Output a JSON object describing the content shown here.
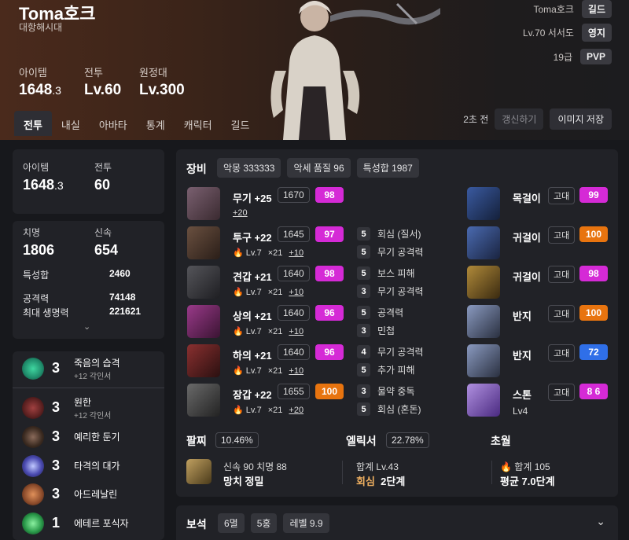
{
  "header": {
    "name": "Toma호크",
    "server": "대항해시대",
    "stats": [
      {
        "label": "아이템",
        "value": "1648",
        "sub": ".3"
      },
      {
        "label": "전투",
        "value": "Lv.60",
        "sub": ""
      },
      {
        "label": "원정대",
        "value": "Lv.300",
        "sub": ""
      }
    ],
    "right": [
      {
        "text": "Toma호크",
        "chip": "길드"
      },
      {
        "text": "Lv.70 서서도",
        "chip": "영지"
      },
      {
        "text": "19급",
        "chip": "PVP"
      }
    ],
    "tabs": [
      "전투",
      "내실",
      "아바타",
      "통계",
      "캐릭터",
      "길드"
    ],
    "refresh": {
      "ago": "2초 전",
      "refresh_label": "갱신하기",
      "save_label": "이미지 저장"
    }
  },
  "summary": {
    "item_label": "아이템",
    "item_value": "1648",
    "item_sub": ".3",
    "combat_label": "전투",
    "combat_value": "60"
  },
  "stats": {
    "crit_label": "치명",
    "crit_value": "1806",
    "swift_label": "신속",
    "swift_value": "654",
    "rows": [
      {
        "label": "특성합",
        "value": "2460"
      },
      {
        "label": "공격력",
        "value": "74148"
      },
      {
        "label": "최대 생명력",
        "value": "221621"
      }
    ],
    "expand": "⌄"
  },
  "engravings": [
    {
      "level": "3",
      "name": "죽음의 습격",
      "sub": "+12 각인서",
      "color": "#1f8a6a"
    },
    {
      "level": "3",
      "name": "원한",
      "sub": "+12 각인서",
      "color": "#6a2a2a"
    },
    {
      "level": "3",
      "name": "예리한 둔기",
      "sub": "",
      "color": "#5a4a3a"
    },
    {
      "level": "3",
      "name": "타격의 대가",
      "sub": "",
      "color": "#4a4ab0"
    },
    {
      "level": "3",
      "name": "아드레날린",
      "sub": "",
      "color": "#8a4a2a"
    },
    {
      "level": "1",
      "name": "에테르 포식자",
      "sub": "",
      "color": "#2a9a4a"
    }
  ],
  "equipment": {
    "title": "장비",
    "tags": [
      "악몽 333333",
      "악세 품질 96",
      "특성합 1987"
    ],
    "items": [
      {
        "name": "무기 +25",
        "ilvl": "1670",
        "quality": "98",
        "qcolor": "#d52ad6",
        "line2": [
          {
            "t": "+20",
            "u": false
          }
        ],
        "color": "#5a4a50"
      },
      {
        "name": "투구 +22",
        "ilvl": "1645",
        "quality": "97",
        "qcolor": "#d52ad6",
        "line2": [
          {
            "t": "🔥 Lv.7",
            "u": false
          },
          {
            "t": "×21",
            "u": false
          },
          {
            "t": "+10",
            "u": true
          }
        ],
        "color": "#4a3a30"
      },
      {
        "name": "견갑 +21",
        "ilvl": "1640",
        "quality": "98",
        "qcolor": "#d52ad6",
        "line2": [
          {
            "t": "🔥 Lv.7",
            "u": false
          },
          {
            "t": "×21",
            "u": false
          },
          {
            "t": "+10",
            "u": true
          }
        ],
        "color": "#3a3a3e"
      },
      {
        "name": "상의 +21",
        "ilvl": "1640",
        "quality": "96",
        "qcolor": "#d52ad6",
        "line2": [
          {
            "t": "🔥 Lv.7",
            "u": false
          },
          {
            "t": "×21",
            "u": false
          },
          {
            "t": "+10",
            "u": true
          }
        ],
        "color": "#6a2a5a"
      },
      {
        "name": "하의 +21",
        "ilvl": "1640",
        "quality": "96",
        "qcolor": "#d52ad6",
        "line2": [
          {
            "t": "🔥 Lv.7",
            "u": false
          },
          {
            "t": "×21",
            "u": false
          },
          {
            "t": "+10",
            "u": true
          }
        ],
        "color": "#5a2a2a"
      },
      {
        "name": "장갑 +22",
        "ilvl": "1655",
        "quality": "100",
        "qcolor": "#e8740f",
        "line2": [
          {
            "t": "🔥 Lv.7",
            "u": false
          },
          {
            "t": "×21",
            "u": false
          },
          {
            "t": "+20",
            "u": true
          }
        ],
        "color": "#4a4a4a"
      }
    ],
    "options": [
      {
        "n": "5",
        "t": "회심 (질서)"
      },
      {
        "n": "5",
        "t": "무기 공격력"
      },
      {
        "n": "5",
        "t": "보스 피해"
      },
      {
        "n": "3",
        "t": "무기 공격력"
      },
      {
        "n": "5",
        "t": "공격력"
      },
      {
        "n": "3",
        "t": "민첩"
      },
      {
        "n": "4",
        "t": "무기 공격력"
      },
      {
        "n": "5",
        "t": "추가 피해"
      },
      {
        "n": "3",
        "t": "물약 중독"
      },
      {
        "n": "5",
        "t": "회심 (혼돈)"
      }
    ],
    "accessories": [
      {
        "name": "목걸이",
        "grade": "고대",
        "quality": "99",
        "qcolor": "#d52ad6",
        "sub": "",
        "color": "#3a4a7a"
      },
      {
        "name": "귀걸이",
        "grade": "고대",
        "quality": "100",
        "qcolor": "#e8740f",
        "sub": "",
        "color": "#3a4a6a"
      },
      {
        "name": "귀걸이",
        "grade": "고대",
        "quality": "98",
        "qcolor": "#d52ad6",
        "sub": "",
        "color": "#6a4a2a"
      },
      {
        "name": "반지",
        "grade": "고대",
        "quality": "100",
        "qcolor": "#e8740f",
        "sub": "",
        "color": "#4a5a7a"
      },
      {
        "name": "반지",
        "grade": "고대",
        "quality": "72",
        "qcolor": "#2f6fe8",
        "sub": "",
        "color": "#4a5a7a"
      },
      {
        "name": "스톤",
        "grade": "고대",
        "quality": "8 6",
        "qcolor": "#d52ad6",
        "sub": "Lv4",
        "color": "#7a5aa0"
      }
    ]
  },
  "bracelet": {
    "title": "팔찌",
    "chip": "10.46%",
    "l1": "신속 90  치명 88",
    "l2": "망치  정밀"
  },
  "elixir": {
    "title": "엘릭서",
    "chip": "22.78%",
    "l1": "합계 Lv.43",
    "l2a": "회심",
    "l2b": "2단계"
  },
  "transcend": {
    "title": "초월",
    "l1": "🔥 합계 105",
    "l2": "평균 7.0단계"
  },
  "gems": {
    "title": "보석",
    "tags": [
      "6멸",
      "5홍",
      "레벨 9.9"
    ],
    "chevron": "⌄"
  }
}
